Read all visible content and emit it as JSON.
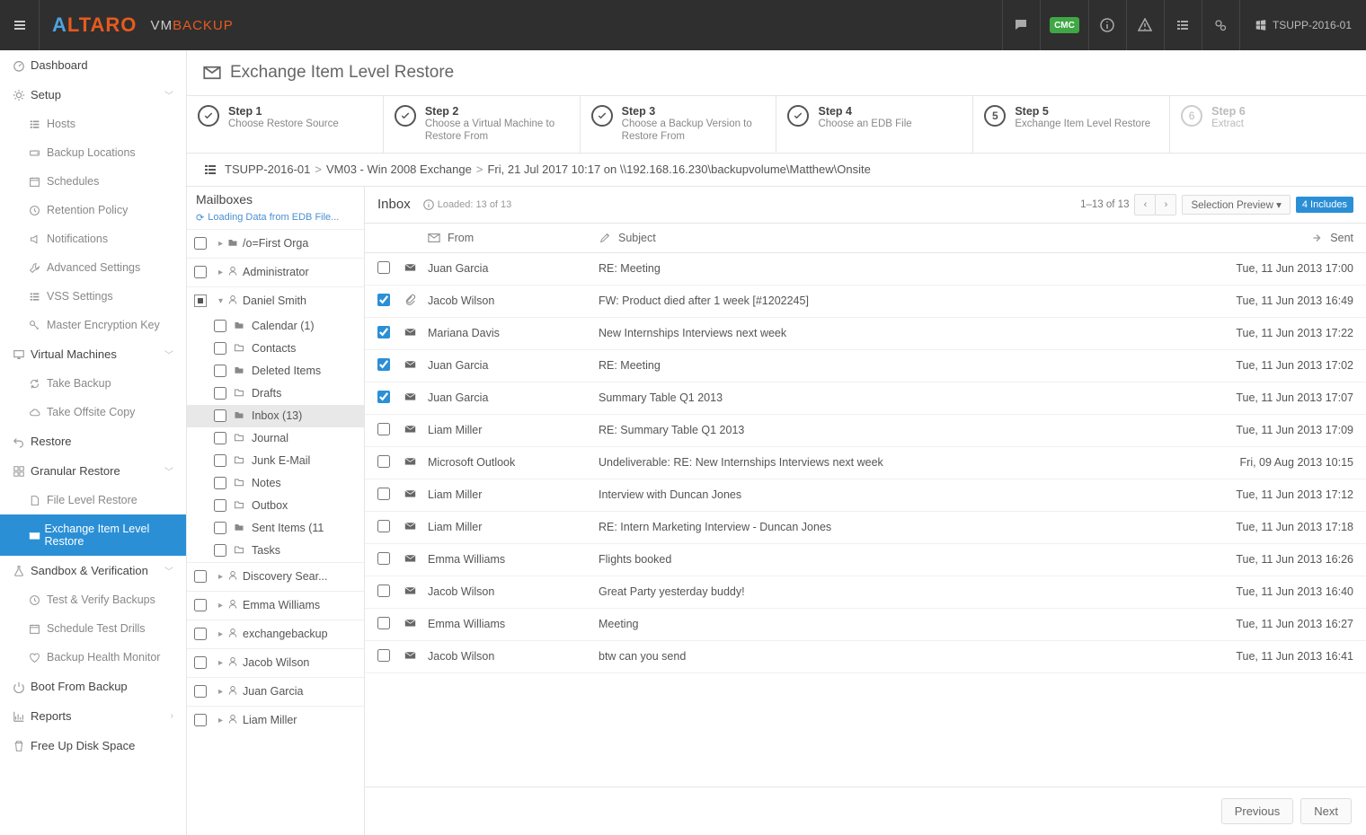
{
  "topbar": {
    "badge": "CMC",
    "server": "TSUPP-2016-01"
  },
  "sidebar": {
    "dashboard": "Dashboard",
    "setup": "Setup",
    "hosts": "Hosts",
    "backup_locations": "Backup Locations",
    "schedules": "Schedules",
    "retention": "Retention Policy",
    "notifications": "Notifications",
    "advanced": "Advanced Settings",
    "vss": "VSS Settings",
    "master_key": "Master Encryption Key",
    "vms": "Virtual Machines",
    "take_backup": "Take Backup",
    "offsite": "Take Offsite Copy",
    "restore": "Restore",
    "granular": "Granular Restore",
    "file_level": "File Level Restore",
    "exchange_level": "Exchange Item Level Restore",
    "sandbox": "Sandbox & Verification",
    "test_verify": "Test & Verify Backups",
    "schedule_drills": "Schedule Test Drills",
    "health": "Backup Health Monitor",
    "boot": "Boot From Backup",
    "reports": "Reports",
    "freeup": "Free Up Disk Space"
  },
  "page": {
    "title": "Exchange Item Level Restore"
  },
  "steps": [
    {
      "title": "Step 1",
      "desc": "Choose Restore Source",
      "state": "done"
    },
    {
      "title": "Step 2",
      "desc": "Choose a Virtual Machine to Restore From",
      "state": "done"
    },
    {
      "title": "Step 3",
      "desc": "Choose a Backup Version to Restore From",
      "state": "done"
    },
    {
      "title": "Step 4",
      "desc": "Choose an EDB File",
      "state": "done"
    },
    {
      "title": "Step 5",
      "desc": "Exchange Item Level Restore",
      "state": "active",
      "num": "5"
    },
    {
      "title": "Step 6",
      "desc": "Extract",
      "state": "future",
      "num": "6"
    }
  ],
  "breadcrumb": {
    "a": "TSUPP-2016-01",
    "b": "VM03 - Win 2008 Exchange",
    "c": "Fri, 21 Jul 2017 10:17 on \\\\192.168.16.230\\backupvolume\\Matthew\\Onsite"
  },
  "mailboxes": {
    "title": "Mailboxes",
    "loading": "Loading Data from EDB File...",
    "top": {
      "label": "/o=First Orga"
    },
    "expanded_user": "Daniel Smith",
    "items": [
      {
        "label": "Administrator"
      },
      {
        "label": "Daniel Smith",
        "expanded": true
      },
      {
        "label": "Discovery Sear..."
      },
      {
        "label": "Emma Williams"
      },
      {
        "label": "exchangebackup"
      },
      {
        "label": "Jacob Wilson"
      },
      {
        "label": "Juan Garcia"
      },
      {
        "label": "Liam Miller"
      }
    ],
    "folders": [
      {
        "label": "Calendar (1)",
        "type": "folder"
      },
      {
        "label": "Contacts",
        "type": "folder-open"
      },
      {
        "label": "Deleted Items",
        "type": "folder"
      },
      {
        "label": "Drafts",
        "type": "folder-open"
      },
      {
        "label": "Inbox (13)",
        "type": "folder",
        "selected": true
      },
      {
        "label": "Journal",
        "type": "folder-open"
      },
      {
        "label": "Junk E-Mail",
        "type": "folder-open"
      },
      {
        "label": "Notes",
        "type": "folder-open"
      },
      {
        "label": "Outbox",
        "type": "folder-open"
      },
      {
        "label": "Sent Items (11",
        "type": "folder"
      },
      {
        "label": "Tasks",
        "type": "folder-open"
      }
    ]
  },
  "inbox": {
    "title": "Inbox",
    "loaded": "Loaded: 13 of 13",
    "range": "1–13 of 13",
    "selection_preview": "Selection Preview",
    "includes": "4 Includes",
    "columns": {
      "from": "From",
      "subject": "Subject",
      "sent": "Sent"
    },
    "rows": [
      {
        "chk": false,
        "att": false,
        "from": "Juan Garcia",
        "subject": "RE: Meeting",
        "sent": "Tue, 11 Jun 2013 17:00"
      },
      {
        "chk": true,
        "att": true,
        "from": "Jacob Wilson",
        "subject": "FW: Product died after 1 week [#1202245]",
        "sent": "Tue, 11 Jun 2013 16:49"
      },
      {
        "chk": true,
        "att": false,
        "from": "Mariana Davis",
        "subject": "New Internships Interviews next week",
        "sent": "Tue, 11 Jun 2013 17:22"
      },
      {
        "chk": true,
        "att": false,
        "from": "Juan Garcia",
        "subject": "RE: Meeting",
        "sent": "Tue, 11 Jun 2013 17:02"
      },
      {
        "chk": true,
        "att": false,
        "from": "Juan Garcia",
        "subject": "Summary Table Q1 2013",
        "sent": "Tue, 11 Jun 2013 17:07"
      },
      {
        "chk": false,
        "att": false,
        "from": "Liam Miller",
        "subject": "RE: Summary Table Q1 2013",
        "sent": "Tue, 11 Jun 2013 17:09"
      },
      {
        "chk": false,
        "att": false,
        "from": "Microsoft Outlook",
        "subject": "Undeliverable: RE: New Internships Interviews next week",
        "sent": "Fri, 09 Aug 2013 10:15"
      },
      {
        "chk": false,
        "att": false,
        "from": "Liam Miller",
        "subject": "Interview with Duncan Jones",
        "sent": "Tue, 11 Jun 2013 17:12"
      },
      {
        "chk": false,
        "att": false,
        "from": "Liam Miller",
        "subject": "RE: Intern Marketing Interview - Duncan Jones",
        "sent": "Tue, 11 Jun 2013 17:18"
      },
      {
        "chk": false,
        "att": false,
        "from": "Emma Williams",
        "subject": "Flights booked",
        "sent": "Tue, 11 Jun 2013 16:26"
      },
      {
        "chk": false,
        "att": false,
        "from": "Jacob Wilson",
        "subject": "Great Party yesterday buddy!",
        "sent": "Tue, 11 Jun 2013 16:40"
      },
      {
        "chk": false,
        "att": false,
        "from": "Emma Williams",
        "subject": "Meeting",
        "sent": "Tue, 11 Jun 2013 16:27"
      },
      {
        "chk": false,
        "att": false,
        "from": "Jacob Wilson",
        "subject": "btw can you send",
        "sent": "Tue, 11 Jun 2013 16:41"
      }
    ]
  },
  "footer": {
    "prev": "Previous",
    "next": "Next"
  }
}
